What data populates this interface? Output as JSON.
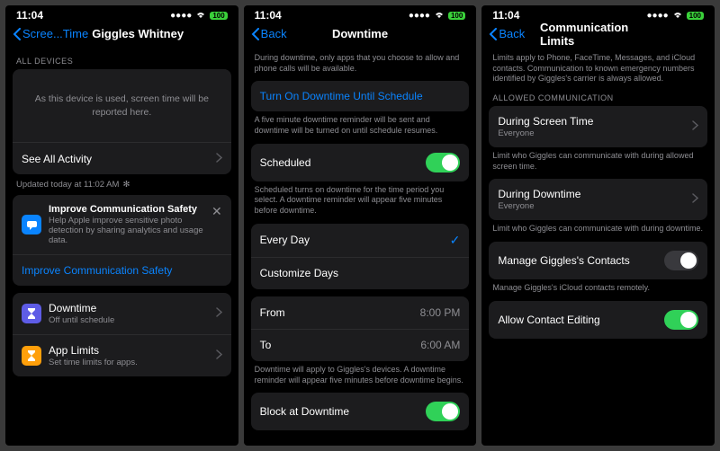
{
  "status": {
    "time": "11:04",
    "battery": "100"
  },
  "s1": {
    "back": "Scree...Time",
    "title": "Giggles Whitney",
    "sec_devices": "ALL DEVICES",
    "report_msg": "As this device is used, screen time will be reported here.",
    "see_all": "See All Activity",
    "updated": "Updated today at 11:02 AM",
    "imp_title": "Improve Communication Safety",
    "imp_body": "Help Apple improve sensitive photo detection by sharing analytics and usage data.",
    "imp_link": "Improve Communication Safety",
    "dt_title": "Downtime",
    "dt_sub": "Off until schedule",
    "al_title": "App Limits",
    "al_sub": "Set time limits for apps."
  },
  "s2": {
    "back": "Back",
    "title": "Downtime",
    "intro": "During downtime, only apps that you choose to allow and phone calls will be available.",
    "turn_on": "Turn On Downtime Until Schedule",
    "turn_on_foot": "A five minute downtime reminder will be sent and downtime will be turned on until schedule resumes.",
    "scheduled": "Scheduled",
    "scheduled_foot": "Scheduled turns on downtime for the time period you select. A downtime reminder will appear five minutes before downtime.",
    "every_day": "Every Day",
    "custom_days": "Customize Days",
    "from": "From",
    "from_v": "8:00 PM",
    "to": "To",
    "to_v": "6:00 AM",
    "time_foot": "Downtime will apply to Giggles's devices. A downtime reminder will appear five minutes before downtime begins.",
    "block": "Block at Downtime"
  },
  "s3": {
    "back": "Back",
    "title": "Communication Limits",
    "intro": "Limits apply to Phone, FaceTime, Messages, and iCloud contacts. Communication to known emergency numbers identified by Giggles's carrier is always allowed.",
    "sec_allowed": "ALLOWED COMMUNICATION",
    "dst_title": "During Screen Time",
    "dst_sub": "Everyone",
    "dst_foot": "Limit who Giggles can communicate with during allowed screen time.",
    "ddt_title": "During Downtime",
    "ddt_sub": "Everyone",
    "ddt_foot": "Limit who Giggles can communicate with during downtime.",
    "manage": "Manage Giggles's Contacts",
    "manage_foot": "Manage Giggles's iCloud contacts remotely.",
    "allow_edit": "Allow Contact Editing"
  }
}
